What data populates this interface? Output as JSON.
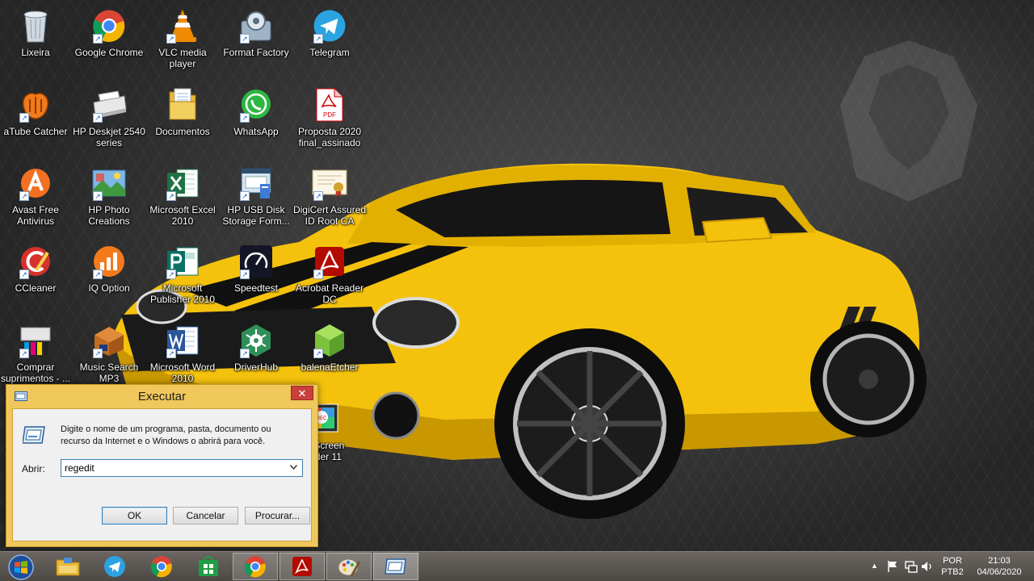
{
  "desktop": {
    "icons": [
      {
        "label": "Lixeira",
        "icon": "recycle-bin-icon"
      },
      {
        "label": "Google Chrome",
        "icon": "chrome-icon"
      },
      {
        "label": "VLC media player",
        "icon": "vlc-icon"
      },
      {
        "label": "Format Factory",
        "icon": "format-factory-icon"
      },
      {
        "label": "Telegram",
        "icon": "telegram-icon"
      },
      {
        "label": "aTube Catcher",
        "icon": "atube-catcher-icon"
      },
      {
        "label": "HP Deskjet 2540 series",
        "icon": "printer-icon"
      },
      {
        "label": "Documentos",
        "icon": "documents-folder-icon"
      },
      {
        "label": "WhatsApp",
        "icon": "whatsapp-icon"
      },
      {
        "label": "Proposta 2020 final_assinado",
        "icon": "pdf-file-icon"
      },
      {
        "label": "Avast Free Antivirus",
        "icon": "avast-icon"
      },
      {
        "label": "HP Photo Creations",
        "icon": "hp-photo-icon"
      },
      {
        "label": "Microsoft Excel 2010",
        "icon": "excel-icon"
      },
      {
        "label": "HP USB Disk Storage Form...",
        "icon": "usb-format-icon"
      },
      {
        "label": "DigiCert Assured ID Root CA",
        "icon": "certificate-icon"
      },
      {
        "label": "CCleaner",
        "icon": "ccleaner-icon"
      },
      {
        "label": "IQ Option",
        "icon": "iq-option-icon"
      },
      {
        "label": "Microsoft Publisher 2010",
        "icon": "publisher-icon"
      },
      {
        "label": "Speedtest",
        "icon": "speedtest-icon"
      },
      {
        "label": "Acrobat Reader DC",
        "icon": "acrobat-icon"
      },
      {
        "label": "Comprar suprimentos - ...",
        "icon": "printer-supplies-icon"
      },
      {
        "label": "Music Search MP3",
        "icon": "music-search-icon"
      },
      {
        "label": "Microsoft Word 2010",
        "icon": "word-icon"
      },
      {
        "label": "DriverHub",
        "icon": "driverhub-icon"
      },
      {
        "label": "balenaEtcher",
        "icon": "balena-etcher-icon"
      },
      {
        "label": "avi Screen corder 11",
        "icon": "screen-recorder-icon"
      }
    ]
  },
  "run_dialog": {
    "title": "Executar",
    "close_label": "✕",
    "description": "Digite o nome de um programa, pasta, documento ou recurso da Internet e o Windows o abrirá para você.",
    "open_label": "Abrir:",
    "input_value": "regedit",
    "ok_label": "OK",
    "cancel_label": "Cancelar",
    "browse_label": "Procurar..."
  },
  "taskbar": {
    "items": [
      {
        "name": "file-explorer",
        "icon": "folder-icon"
      },
      {
        "name": "telegram",
        "icon": "telegram-icon"
      },
      {
        "name": "chrome",
        "icon": "chrome-icon"
      },
      {
        "name": "store",
        "icon": "store-icon"
      },
      {
        "name": "chrome-window",
        "icon": "chrome-icon"
      },
      {
        "name": "acrobat",
        "icon": "acrobat-icon"
      },
      {
        "name": "paint",
        "icon": "paint-icon"
      },
      {
        "name": "run",
        "icon": "run-icon"
      }
    ],
    "tray": {
      "language": "POR",
      "keyboard": "PTB2",
      "time": "21:03",
      "date": "04/06/2020"
    }
  }
}
